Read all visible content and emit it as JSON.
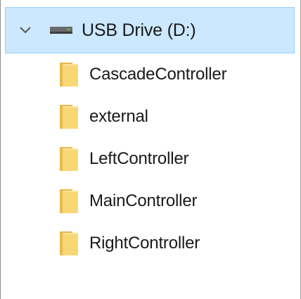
{
  "tree": {
    "drive": {
      "label": "USB Drive (D:)",
      "icon": "drive-icon",
      "expanded": true
    },
    "folders": [
      {
        "label": "CascadeController",
        "icon": "folder-icon"
      },
      {
        "label": "external",
        "icon": "folder-icon"
      },
      {
        "label": "LeftController",
        "icon": "folder-icon"
      },
      {
        "label": "MainController",
        "icon": "folder-icon"
      },
      {
        "label": "RightController",
        "icon": "folder-icon"
      }
    ]
  },
  "colors": {
    "selection_bg": "#cce8ff",
    "selection_border": "#99d1ff",
    "folder_fill": "#f8d775",
    "folder_back": "#e8b94a",
    "text": "#1a1a1a"
  }
}
